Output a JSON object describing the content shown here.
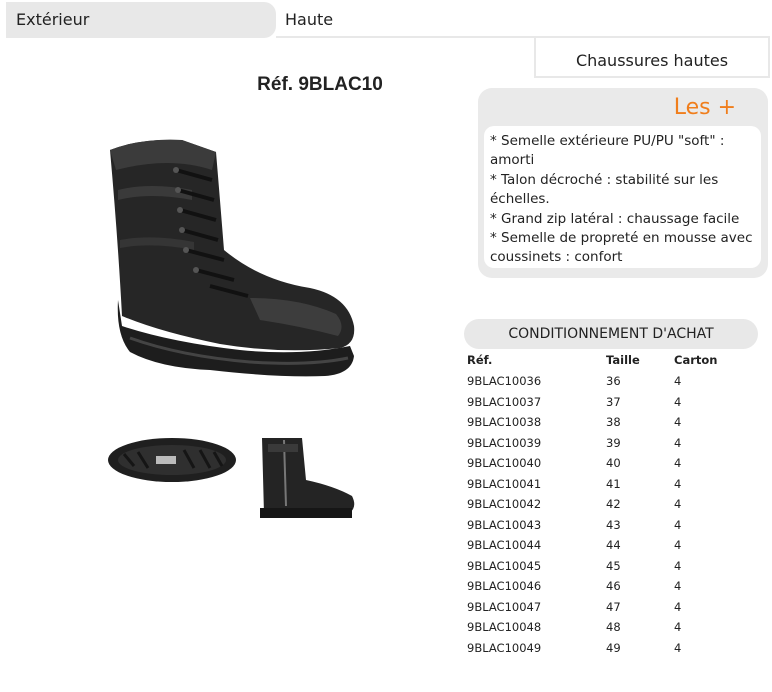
{
  "header": {
    "section": "Extérieur",
    "type": "Haute",
    "category": "Chaussures hautes"
  },
  "product": {
    "reference_title": "Réf. 9BLAC10"
  },
  "advantages": {
    "title": "Les +",
    "items": [
      "* Semelle extérieure PU/PU \"soft\" : amorti",
      "* Talon décroché : stabilité sur les échelles.",
      "* Grand zip latéral : chaussage facile",
      "* Semelle de propreté en mousse avec coussinets : confort"
    ]
  },
  "packaging": {
    "title": "CONDITIONNEMENT D'ACHAT",
    "columns": [
      "Réf.",
      "Taille",
      "Carton"
    ],
    "rows": [
      [
        "9BLAC10036",
        "36",
        "4"
      ],
      [
        "9BLAC10037",
        "37",
        "4"
      ],
      [
        "9BLAC10038",
        "38",
        "4"
      ],
      [
        "9BLAC10039",
        "39",
        "4"
      ],
      [
        "9BLAC10040",
        "40",
        "4"
      ],
      [
        "9BLAC10041",
        "41",
        "4"
      ],
      [
        "9BLAC10042",
        "42",
        "4"
      ],
      [
        "9BLAC10043",
        "43",
        "4"
      ],
      [
        "9BLAC10044",
        "44",
        "4"
      ],
      [
        "9BLAC10045",
        "45",
        "4"
      ],
      [
        "9BLAC10046",
        "46",
        "4"
      ],
      [
        "9BLAC10047",
        "47",
        "4"
      ],
      [
        "9BLAC10048",
        "48",
        "4"
      ],
      [
        "9BLAC10049",
        "49",
        "4"
      ]
    ]
  },
  "colors": {
    "accent": "#f07e1c",
    "panel": "#e8e8e8"
  }
}
